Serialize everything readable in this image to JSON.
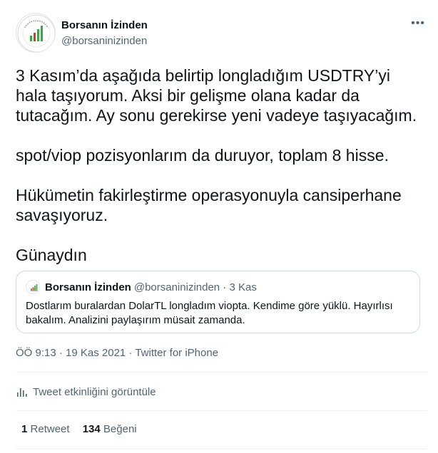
{
  "author": {
    "name": "Borsanın İzinden",
    "handle": "@borsaninizinden",
    "avatar_icon": "chart-logo-icon"
  },
  "more_menu": {
    "label": "•••",
    "icon": "more-horizontal-icon"
  },
  "tweet": {
    "paragraphs": [
      "3 Kasım’da aşağıda belirtip longladığım USDTRY’yi hala taşıyorum. Aksi bir gelişme olana kadar da tutacağım. Ay sonu gerekirse yeni vadeye taşıyacağım.",
      "spot/viop pozisyonlarım da duruyor, toplam 8 hisse.",
      "Hükümetin fakirleştirme operasyonuyla cansiperhane savaşıyoruz.",
      "Günaydın"
    ]
  },
  "quote": {
    "name": "Borsanın İzinden",
    "handle_date": "@borsaninizinden · 3 Kas",
    "text": "Dostlarım buralardan DolarTL longladım viopta. Kendime göre yüklü. Hayırlısı bakalım. Analizini paylaşırım müsait zamanda."
  },
  "meta": {
    "time_date": "ÖÖ 9:13 · 19 Kas 2021 · ",
    "source": "Twitter for iPhone"
  },
  "activity": {
    "label": "Tweet etkinliğini görüntüle",
    "icon": "bar-chart-icon"
  },
  "stats": {
    "retweets_count": "1",
    "retweets_label": "Retweet",
    "likes_count": "134",
    "likes_label": "Beğeni"
  },
  "colors": {
    "text": "#0f1419",
    "secondary": "#536471",
    "border": "#cfd9de",
    "divider": "#eff3f4",
    "logo_green": "#3aa845",
    "logo_red": "#d23a2e"
  }
}
